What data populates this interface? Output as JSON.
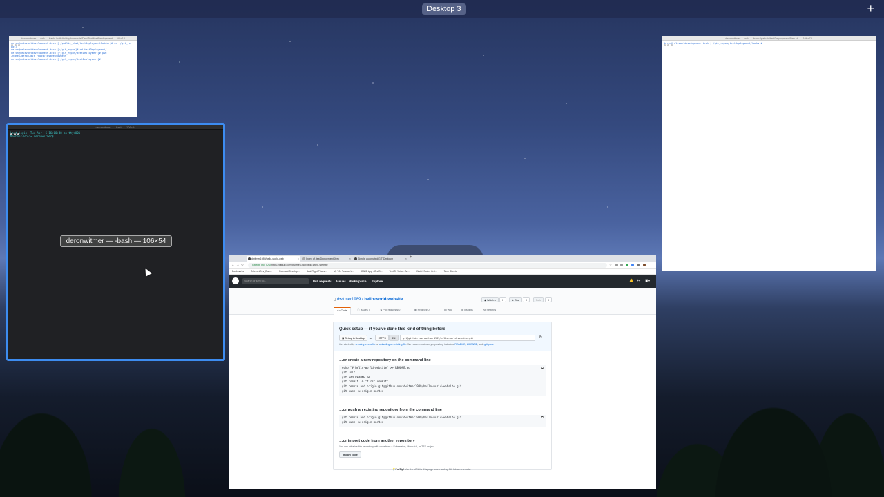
{
  "mission_control": {
    "desktop_label": "Desktop 3",
    "add_button": "+"
  },
  "terminal_small": {
    "title": "deronwitmer — ssh — bash /path/to/deployments/Dev/Test/testDeployment — 40×18",
    "lines": [
      "deron@relevantdevelopment.tech [~/public_html/testDeploymentFolder]# cd ~/git_re",
      "pos/",
      "deron@relevantdevelopment.tech [~/git_repos]# cd testDeployment/",
      "deron@relevantdevelopment.tech [~/git_repos/testDeployment]# pwd",
      "/home1/deron/git_repos/testDeployment",
      "deron@relevantdevelopment.tech [~/git_repos/testDeployment]# "
    ]
  },
  "terminal_main": {
    "title": "deronwitmer — -bash — 106×54",
    "lines": [
      "Last login: Tue Apr  6 16:00:48 on ttys001",
      "Macbook-Pro:~ deronwitmer$ "
    ],
    "window_label": "deronwitmer — -bash — 106×54"
  },
  "terminal_right": {
    "title": "deronwitmer — ssh — bash /path/to/testDeployment/Dev.sh — 106×73",
    "lines": [
      "deron@relevantdevelopment.tech [~/git_repos/testDeployment/hooks]# "
    ]
  },
  "browser": {
    "tabs": [
      {
        "label": "dwitmer1989/hello-world-web",
        "active": true
      },
      {
        "label": "Index of /testDeploymentDirec",
        "active": false
      },
      {
        "label": "Simple automated GIT Deploym",
        "active": false
      }
    ],
    "address": {
      "secure_label": "GitHub, Inc. [US]",
      "url": "https://github.com/dwitmer1989/hello-world-website"
    },
    "bookmarks": [
      "Bookmarks",
      "RelevantDev_Dom...",
      "Relevant Develop...",
      "Best Flight Prices...",
      "My TJ - Towson U...",
      "CARE App - OneD...",
      "Text To Voice - Ac...",
      "Watch Series Onli...",
      "Time Sheets"
    ]
  },
  "github": {
    "search_placeholder": "Search or jump to...",
    "nav": [
      "Pull requests",
      "Issues",
      "Marketplace",
      "Explore"
    ],
    "repo_owner": "dwitmer1989",
    "repo_sep": " / ",
    "repo_name": "hello-world-website",
    "watch_label": "Watch",
    "watch_count": "0",
    "star_label": "Star",
    "star_count": "0",
    "fork_label": "Fork",
    "fork_count": "0",
    "tabs": [
      {
        "label": "Code",
        "count": ""
      },
      {
        "label": "Issues",
        "count": "0"
      },
      {
        "label": "Pull requests",
        "count": "0"
      },
      {
        "label": "Projects",
        "count": "0"
      },
      {
        "label": "Wiki",
        "count": ""
      },
      {
        "label": "Insights",
        "count": ""
      },
      {
        "label": "Settings",
        "count": ""
      }
    ],
    "quick_setup": {
      "title": "Quick setup — if you've done this kind of thing before",
      "desktop_btn": "Set up in Desktop",
      "or": "or",
      "https_btn": "HTTPS",
      "ssh_btn": "SSH",
      "clone_url": "git@github.com:dwitmer1989/hello-world-website.git",
      "help_prefix": "Get started by ",
      "help_link1": "creating a new file",
      "help_or": " or ",
      "help_link2": "uploading an existing file",
      "help_mid": ". We recommend every repository include a ",
      "help_link3": "README",
      "help_comma": ", ",
      "help_link4": "LICENSE",
      "help_and": ", and ",
      "help_link5": ".gitignore",
      "help_end": "."
    },
    "create_section": {
      "title": "…or create a new repository on the command line",
      "code": "echo \"# hello-world-website\" >> README.md\ngit init\ngit add README.md\ngit commit -m \"first commit\"\ngit remote add origin git@github.com:dwitmer1989/hello-world-website.git\ngit push -u origin master"
    },
    "push_section": {
      "title": "…or push an existing repository from the command line",
      "code": "git remote add origin git@github.com:dwitmer1989/hello-world-website.git\ngit push -u origin master"
    },
    "import_section": {
      "title": "…or import code from another repository",
      "note": "You can initialize this repository with code from a Subversion, Mercurial, or TFS project.",
      "button": "Import code"
    },
    "protip_label": "ProTip!",
    "protip_text": " Use the URL for this page when adding GitHub as a remote."
  }
}
